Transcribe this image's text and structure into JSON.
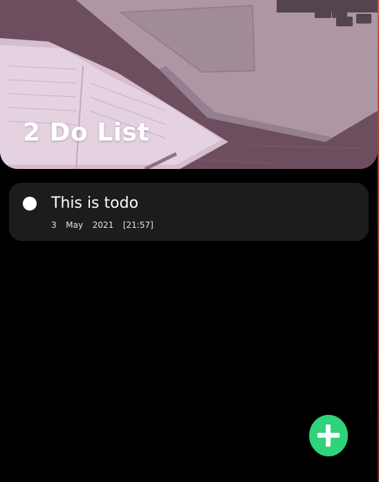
{
  "header": {
    "title": "2 Do List",
    "image_description_icon": "notebook-laptop-photo"
  },
  "todos": [
    {
      "text": "This is todo",
      "date": "3  May  2021  [21:57]",
      "completed": false
    }
  ],
  "fab": {
    "icon": "plus-icon",
    "color": "#2ed37a"
  },
  "colors": {
    "background": "#000000",
    "card": "#1c1c1c",
    "accent": "#2ed37a",
    "text": "#ffffff"
  }
}
